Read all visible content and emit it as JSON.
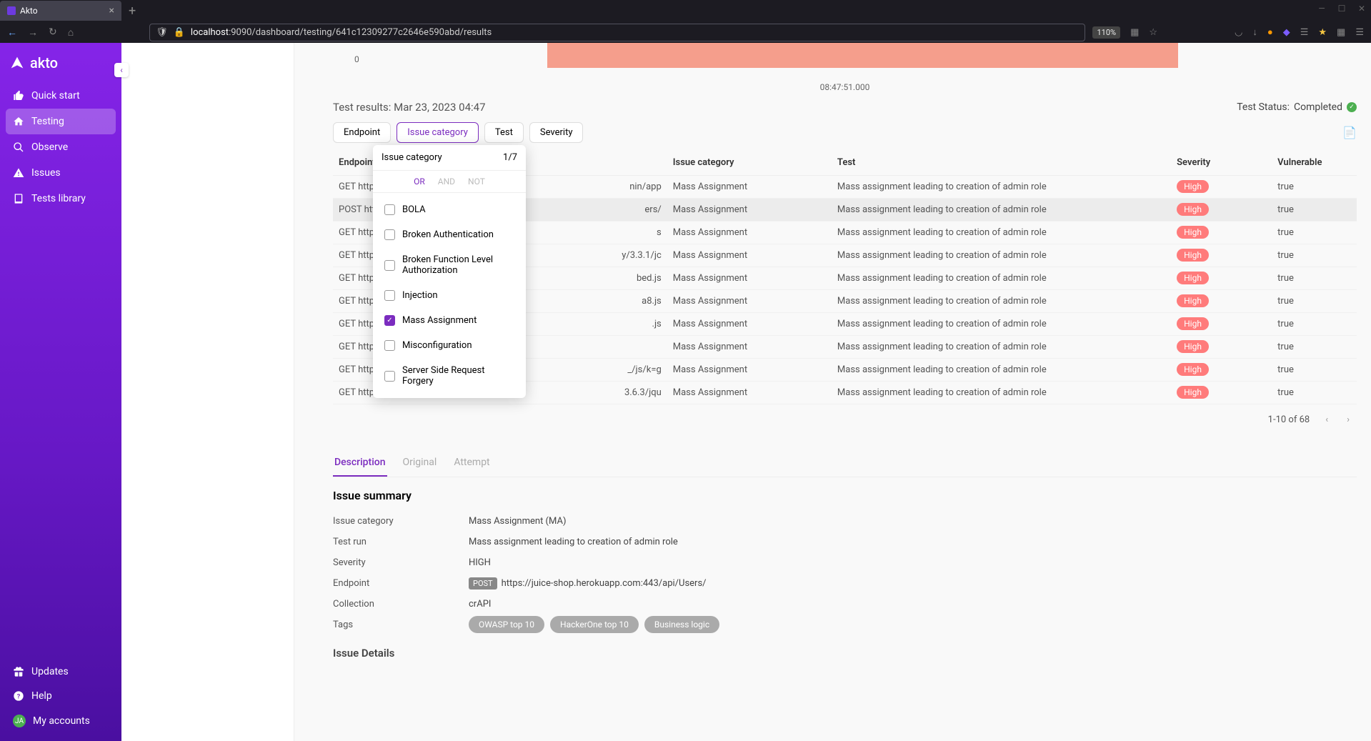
{
  "browser": {
    "tab_title": "Akto",
    "url_full": "localhost:9090/dashboard/testing/641c12309277c2646e590abd/results",
    "url_host": "localhost",
    "url_path": ":9090/dashboard/testing/641c12309277c2646e590abd/results",
    "zoom": "110%"
  },
  "sidebar": {
    "logo": "akto",
    "items": [
      {
        "label": "Quick start"
      },
      {
        "label": "Testing"
      },
      {
        "label": "Observe"
      },
      {
        "label": "Issues"
      },
      {
        "label": "Tests library"
      }
    ],
    "bottom": [
      {
        "label": "Updates"
      },
      {
        "label": "Help"
      },
      {
        "label": "My accounts",
        "avatar_initials": "JA"
      }
    ]
  },
  "chart": {
    "zero_label": "0",
    "time_label": "08:47:51.000"
  },
  "results": {
    "title": "Test results: Mar 23, 2023 04:47",
    "status_label": "Test Status:",
    "status_value": "Completed"
  },
  "filters": {
    "chips": [
      "Endpoint",
      "Issue category",
      "Test",
      "Severity"
    ]
  },
  "dropdown": {
    "title": "Issue category",
    "count": "1/7",
    "ops": [
      "OR",
      "AND",
      "NOT"
    ],
    "options": [
      {
        "label": "BOLA",
        "checked": false
      },
      {
        "label": "Broken Authentication",
        "checked": false
      },
      {
        "label": "Broken Function Level Authorization",
        "checked": false
      },
      {
        "label": "Injection",
        "checked": false
      },
      {
        "label": "Mass Assignment",
        "checked": true
      },
      {
        "label": "Misconfiguration",
        "checked": false
      },
      {
        "label": "Server Side Request Forgery",
        "checked": false
      }
    ]
  },
  "table": {
    "headers": [
      "Endpoint",
      "Issue category",
      "Test",
      "Severity",
      "Vulnerable"
    ],
    "rows": [
      {
        "endpoint": "GET https:/",
        "tail": "nin/app",
        "cat": "Mass Assignment",
        "test": "Mass assignment leading to creation of admin role",
        "sev": "High",
        "vuln": "true",
        "hl": false
      },
      {
        "endpoint": "POST https:",
        "tail": "ers/",
        "cat": "Mass Assignment",
        "test": "Mass assignment leading to creation of admin role",
        "sev": "High",
        "vuln": "true",
        "hl": true
      },
      {
        "endpoint": "GET https:/",
        "tail": "s",
        "cat": "Mass Assignment",
        "test": "Mass assignment leading to creation of admin role",
        "sev": "High",
        "vuln": "true",
        "hl": false
      },
      {
        "endpoint": "GET https:/",
        "tail": "y/3.3.1/jc",
        "cat": "Mass Assignment",
        "test": "Mass assignment leading to creation of admin role",
        "sev": "High",
        "vuln": "true",
        "hl": false
      },
      {
        "endpoint": "GET https:/",
        "tail": "bed.js",
        "cat": "Mass Assignment",
        "test": "Mass assignment leading to creation of admin role",
        "sev": "High",
        "vuln": "true",
        "hl": false
      },
      {
        "endpoint": "GET https:/",
        "tail": "a8.js",
        "cat": "Mass Assignment",
        "test": "Mass assignment leading to creation of admin role",
        "sev": "High",
        "vuln": "true",
        "hl": false
      },
      {
        "endpoint": "GET https:/",
        "tail": ".js",
        "cat": "Mass Assignment",
        "test": "Mass assignment leading to creation of admin role",
        "sev": "High",
        "vuln": "true",
        "hl": false
      },
      {
        "endpoint": "GET https:/",
        "tail": "",
        "cat": "Mass Assignment",
        "test": "Mass assignment leading to creation of admin role",
        "sev": "High",
        "vuln": "true",
        "hl": false
      },
      {
        "endpoint": "GET https:/",
        "tail": "_/js/k=g",
        "cat": "Mass Assignment",
        "test": "Mass assignment leading to creation of admin role",
        "sev": "High",
        "vuln": "true",
        "hl": false
      },
      {
        "endpoint": "GET http://",
        "tail": "3.6.3/jqu",
        "cat": "Mass Assignment",
        "test": "Mass assignment leading to creation of admin role",
        "sev": "High",
        "vuln": "true",
        "hl": false
      }
    ],
    "pagination": "1-10 of 68"
  },
  "detail": {
    "tabs": [
      "Description",
      "Original",
      "Attempt"
    ],
    "summary_title": "Issue summary",
    "rows": [
      {
        "label": "Issue category",
        "value": "Mass Assignment (MA)"
      },
      {
        "label": "Test run",
        "value": "Mass assignment leading to creation of admin role"
      },
      {
        "label": "Severity",
        "value": "HIGH"
      },
      {
        "label": "Endpoint",
        "method": "POST",
        "value": "https://juice-shop.herokuapp.com:443/api/Users/"
      },
      {
        "label": "Collection",
        "value": "crAPI"
      },
      {
        "label": "Tags",
        "tags": [
          "OWASP top 10",
          "HackerOne top 10",
          "Business logic"
        ]
      }
    ],
    "issue_details_title": "Issue Details"
  }
}
